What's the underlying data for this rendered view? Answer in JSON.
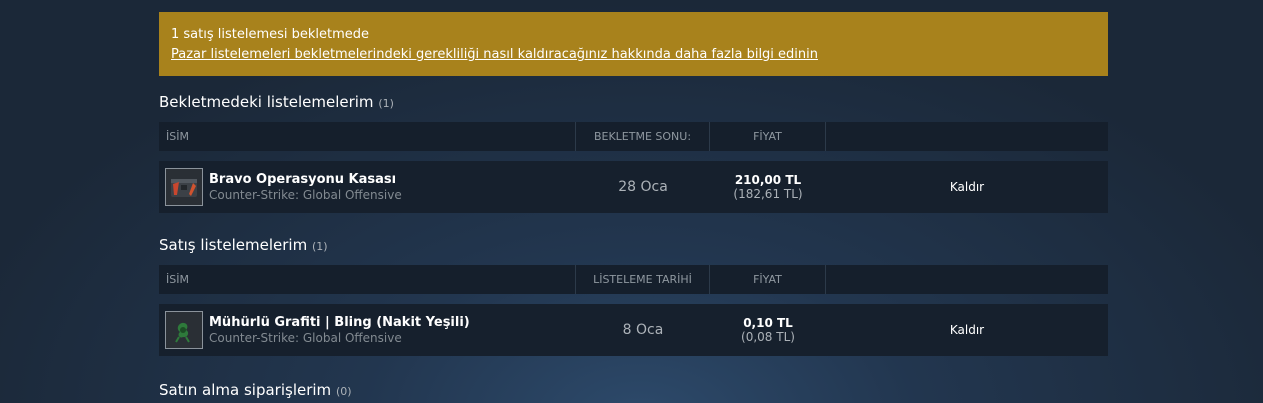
{
  "notice": {
    "title": "1 satış listelemesi bekletmede",
    "link": "Pazar listelemeleri bekletmelerindeki gerekliliği nasıl kaldıracağınız hakkında daha fazla bilgi edinin",
    "bg_color": "#a8821c"
  },
  "pending": {
    "title": "Bekletmedeki listelemelerim",
    "count": "(1)",
    "headers": {
      "name": "İSİM",
      "date": "BEKLETME SONU:",
      "price": "FİYAT"
    },
    "rows": [
      {
        "icon": "weapon-case-icon",
        "name": "Bravo Operasyonu Kasası",
        "game": "Counter-Strike: Global Offensive",
        "date": "28 Oca",
        "price": "210,00 TL",
        "price_sub": "(182,61 TL)",
        "action": "Kaldır"
      }
    ]
  },
  "listings": {
    "title": "Satış listelemelerim",
    "count": "(1)",
    "headers": {
      "name": "İSİM",
      "date": "LİSTELEME TARİHİ",
      "price": "FİYAT"
    },
    "rows": [
      {
        "icon": "graffiti-icon",
        "name": "Mühürlü Grafiti | Bling (Nakit Yeşili)",
        "game": "Counter-Strike: Global Offensive",
        "date": "8 Oca",
        "price": "0,10 TL",
        "price_sub": "(0,08 TL)",
        "action": "Kaldır"
      }
    ]
  },
  "buy_orders": {
    "title": "Satın alma siparişlerim",
    "count": "(0)"
  }
}
